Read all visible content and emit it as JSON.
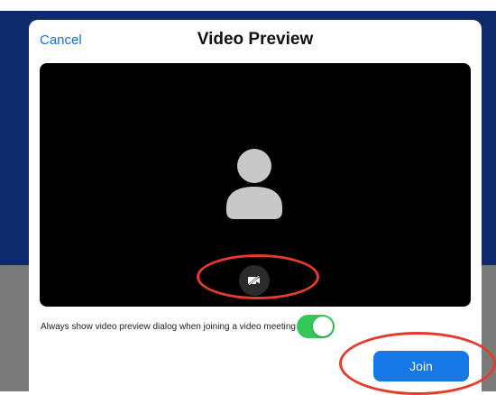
{
  "dialog": {
    "title": "Video Preview",
    "cancel_label": "Cancel"
  },
  "preview": {
    "avatar_icon": "person-silhouette-icon",
    "camera_button_icon": "video-off-icon"
  },
  "settings": {
    "always_show_label": "Always show video preview dialog when joining a video meeting",
    "always_show_enabled": true,
    "toggle_color": "#34c759"
  },
  "actions": {
    "join_label": "Join",
    "join_color": "#1677e6",
    "cancel_color": "#1a6fd6"
  },
  "annotations": {
    "highlight_color": "#e53b2c"
  }
}
